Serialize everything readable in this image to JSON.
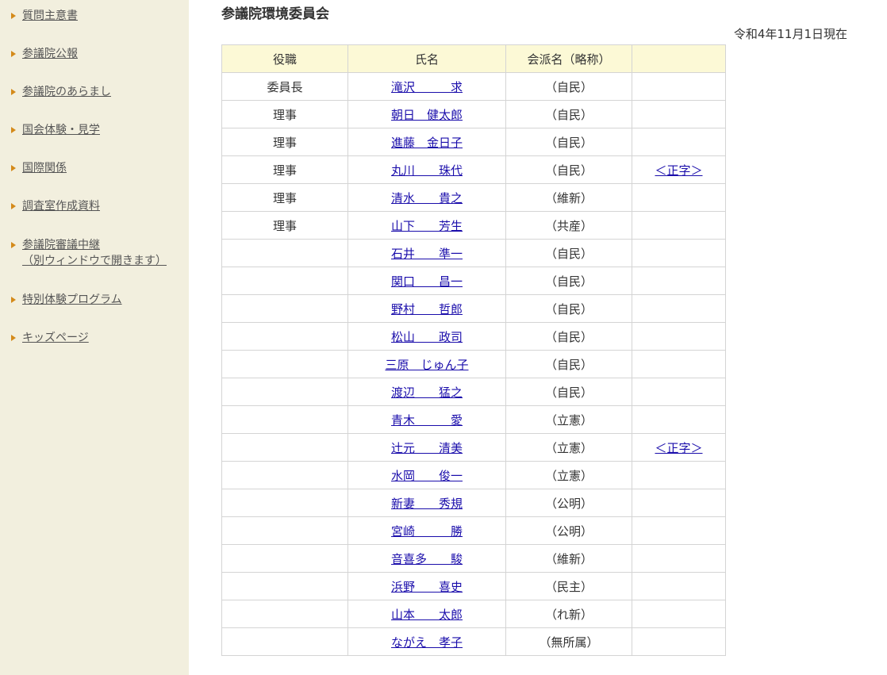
{
  "sidebar": {
    "items": [
      {
        "label": "質問主意書"
      },
      {
        "label": "参議院公報"
      },
      {
        "label": "参議院のあらまし"
      },
      {
        "label": "国会体験・見学"
      },
      {
        "label": "国際関係"
      },
      {
        "label": "調査室作成資料"
      },
      {
        "label": "参議院審議中継",
        "sublabel": "（別ウィンドウで開きます）"
      },
      {
        "label": "特別体験プログラム"
      },
      {
        "label": "キッズページ"
      }
    ],
    "bullet_color": "#d48a1a",
    "background": "#f2efde"
  },
  "main": {
    "title": "参議院環境委員会",
    "as_of": "令和4年11月1日現在",
    "table": {
      "headers": [
        "役職",
        "氏名",
        "会派名（略称）",
        ""
      ],
      "rows": [
        {
          "role": "委員長",
          "name": "滝沢　　　求",
          "party": "（自民）",
          "note": ""
        },
        {
          "role": "理事",
          "name": "朝日　健太郎",
          "party": "（自民）",
          "note": ""
        },
        {
          "role": "理事",
          "name": "進藤　金日子",
          "party": "（自民）",
          "note": ""
        },
        {
          "role": "理事",
          "name": "丸川　　珠代",
          "party": "（自民）",
          "note": "＜正字＞"
        },
        {
          "role": "理事",
          "name": "清水　　貴之",
          "party": "（維新）",
          "note": ""
        },
        {
          "role": "理事",
          "name": "山下　　芳生",
          "party": "（共産）",
          "note": ""
        },
        {
          "role": "",
          "name": "石井　　準一",
          "party": "（自民）",
          "note": ""
        },
        {
          "role": "",
          "name": "関口　　昌一",
          "party": "（自民）",
          "note": ""
        },
        {
          "role": "",
          "name": "野村　　哲郎",
          "party": "（自民）",
          "note": ""
        },
        {
          "role": "",
          "name": "松山　　政司",
          "party": "（自民）",
          "note": ""
        },
        {
          "role": "",
          "name": "三原　じゅん子",
          "party": "（自民）",
          "note": ""
        },
        {
          "role": "",
          "name": "渡辺　　猛之",
          "party": "（自民）",
          "note": ""
        },
        {
          "role": "",
          "name": "青木　　　愛",
          "party": "（立憲）",
          "note": ""
        },
        {
          "role": "",
          "name": "辻元　　清美",
          "party": "（立憲）",
          "note": "＜正字＞"
        },
        {
          "role": "",
          "name": "水岡　　俊一",
          "party": "（立憲）",
          "note": ""
        },
        {
          "role": "",
          "name": "新妻　　秀規",
          "party": "（公明）",
          "note": ""
        },
        {
          "role": "",
          "name": "宮崎　　　勝",
          "party": "（公明）",
          "note": ""
        },
        {
          "role": "",
          "name": "音喜多　　駿",
          "party": "（維新）",
          "note": ""
        },
        {
          "role": "",
          "name": "浜野　　喜史",
          "party": "（民主）",
          "note": ""
        },
        {
          "role": "",
          "name": "山本　　太郎",
          "party": "（れ新）",
          "note": ""
        },
        {
          "role": "",
          "name": "ながえ　孝子",
          "party": "（無所属）",
          "note": ""
        }
      ]
    },
    "colors": {
      "header_bg": "#fcf9d6",
      "border": "#d4d4d4",
      "link": "#1a0dab"
    }
  }
}
